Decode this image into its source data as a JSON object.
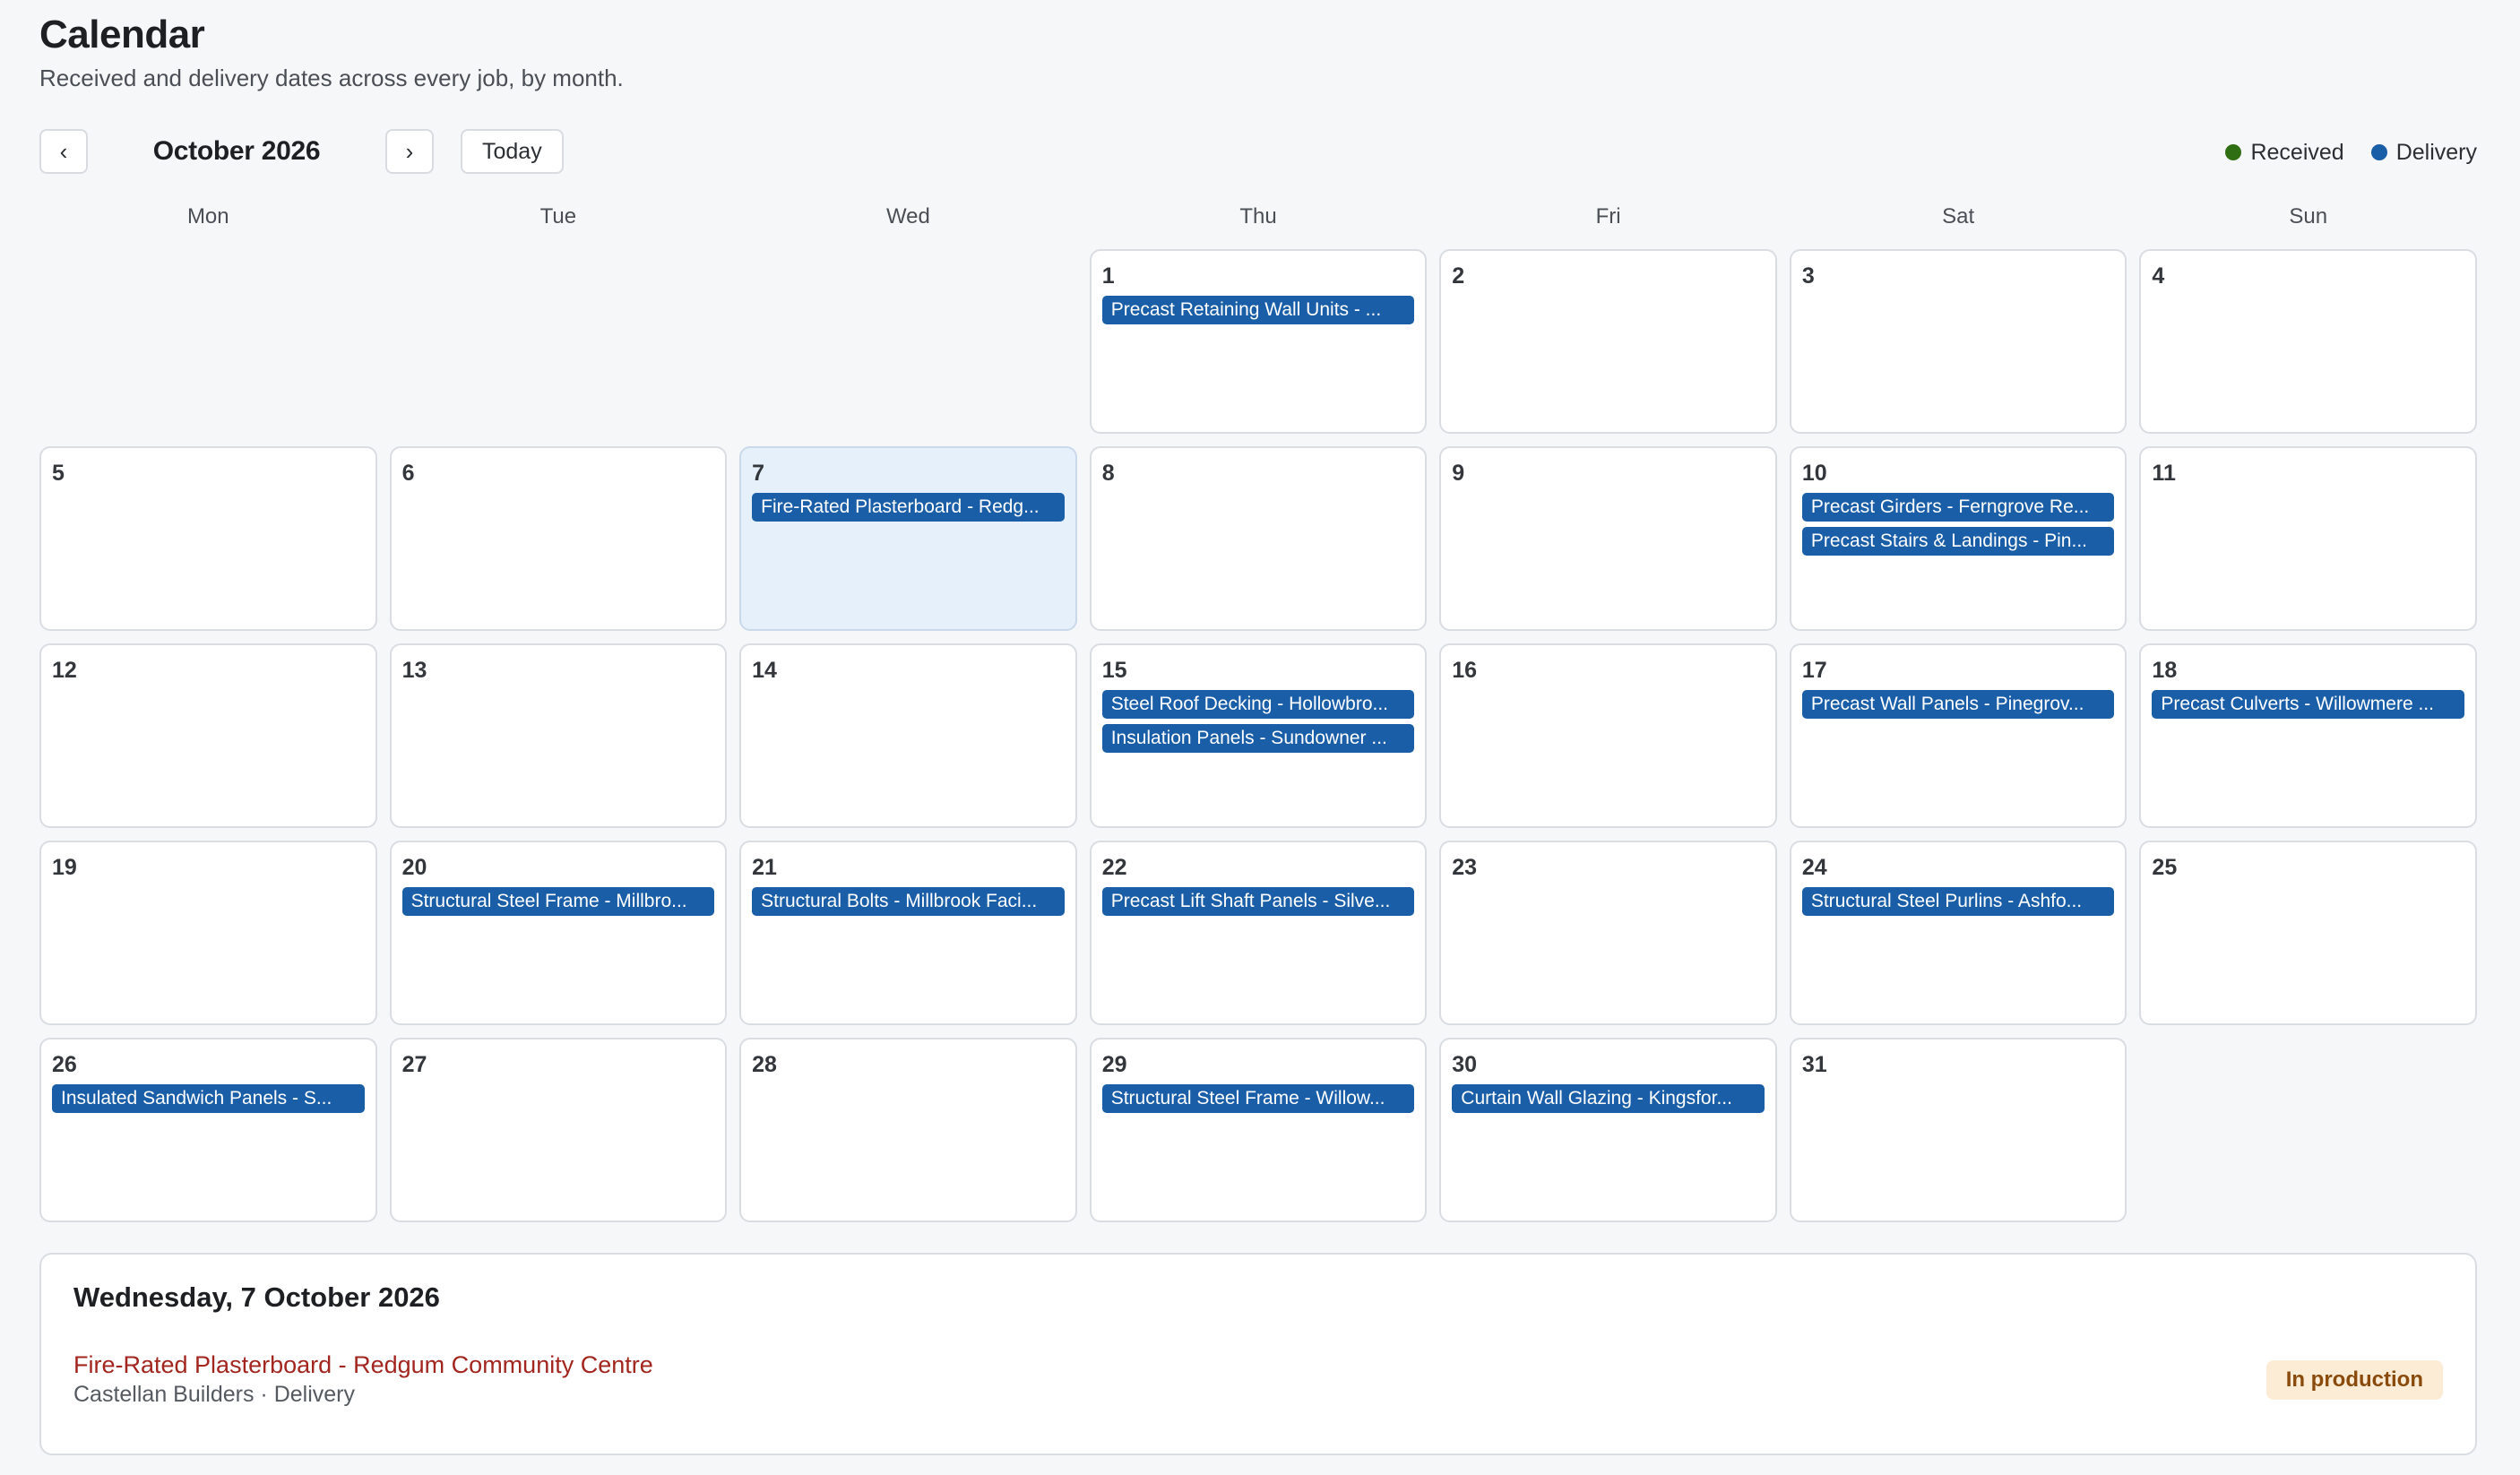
{
  "colors": {
    "received": "#2f6e12",
    "delivery": "#1a5ea8",
    "badge_bg": "#fcecd6",
    "badge_text": "#8a4a0b"
  },
  "header": {
    "title": "Calendar",
    "subtitle": "Received and delivery dates across every job, by month."
  },
  "toolbar": {
    "prev_label": "‹",
    "next_label": "›",
    "month_label": "October 2026",
    "today_label": "Today"
  },
  "legend": {
    "received_label": "Received",
    "delivery_label": "Delivery"
  },
  "weekdays": [
    "Mon",
    "Tue",
    "Wed",
    "Thu",
    "Fri",
    "Sat",
    "Sun"
  ],
  "calendar": {
    "leading_blank_days": 3,
    "selected_day": 7,
    "days": [
      {
        "day": "1",
        "events": [
          {
            "title": "Precast Retaining Wall Units - ...",
            "type": "delivery"
          }
        ]
      },
      {
        "day": "2",
        "events": []
      },
      {
        "day": "3",
        "events": []
      },
      {
        "day": "4",
        "events": []
      },
      {
        "day": "5",
        "events": []
      },
      {
        "day": "6",
        "events": []
      },
      {
        "day": "7",
        "events": [
          {
            "title": "Fire-Rated Plasterboard - Redg...",
            "type": "delivery"
          }
        ]
      },
      {
        "day": "8",
        "events": []
      },
      {
        "day": "9",
        "events": []
      },
      {
        "day": "10",
        "events": [
          {
            "title": "Precast Girders - Ferngrove Re...",
            "type": "delivery"
          },
          {
            "title": "Precast Stairs & Landings - Pin...",
            "type": "delivery"
          }
        ]
      },
      {
        "day": "11",
        "events": []
      },
      {
        "day": "12",
        "events": []
      },
      {
        "day": "13",
        "events": []
      },
      {
        "day": "14",
        "events": []
      },
      {
        "day": "15",
        "events": [
          {
            "title": "Steel Roof Decking - Hollowbro...",
            "type": "delivery"
          },
          {
            "title": "Insulation Panels - Sundowner ...",
            "type": "delivery"
          }
        ]
      },
      {
        "day": "16",
        "events": []
      },
      {
        "day": "17",
        "events": [
          {
            "title": "Precast Wall Panels - Pinegrov...",
            "type": "delivery"
          }
        ]
      },
      {
        "day": "18",
        "events": [
          {
            "title": "Precast Culverts - Willowmere ...",
            "type": "delivery"
          }
        ]
      },
      {
        "day": "19",
        "events": []
      },
      {
        "day": "20",
        "events": [
          {
            "title": "Structural Steel Frame - Millbro...",
            "type": "delivery"
          }
        ]
      },
      {
        "day": "21",
        "events": [
          {
            "title": "Structural Bolts - Millbrook Faci...",
            "type": "delivery"
          }
        ]
      },
      {
        "day": "22",
        "events": [
          {
            "title": "Precast Lift Shaft Panels - Silve...",
            "type": "delivery"
          }
        ]
      },
      {
        "day": "23",
        "events": []
      },
      {
        "day": "24",
        "events": [
          {
            "title": "Structural Steel Purlins - Ashfo...",
            "type": "delivery"
          }
        ]
      },
      {
        "day": "25",
        "events": []
      },
      {
        "day": "26",
        "events": [
          {
            "title": "Insulated Sandwich Panels - S...",
            "type": "delivery"
          }
        ]
      },
      {
        "day": "27",
        "events": []
      },
      {
        "day": "28",
        "events": []
      },
      {
        "day": "29",
        "events": [
          {
            "title": "Structural Steel Frame - Willow...",
            "type": "delivery"
          }
        ]
      },
      {
        "day": "30",
        "events": [
          {
            "title": "Curtain Wall Glazing - Kingsfor...",
            "type": "delivery"
          }
        ]
      },
      {
        "day": "31",
        "events": []
      }
    ]
  },
  "detail": {
    "date_title": "Wednesday, 7 October 2026",
    "event_name": "Fire-Rated Plasterboard - Redgum Community Centre",
    "event_meta": "Castellan Builders · Delivery",
    "status": "In production"
  }
}
